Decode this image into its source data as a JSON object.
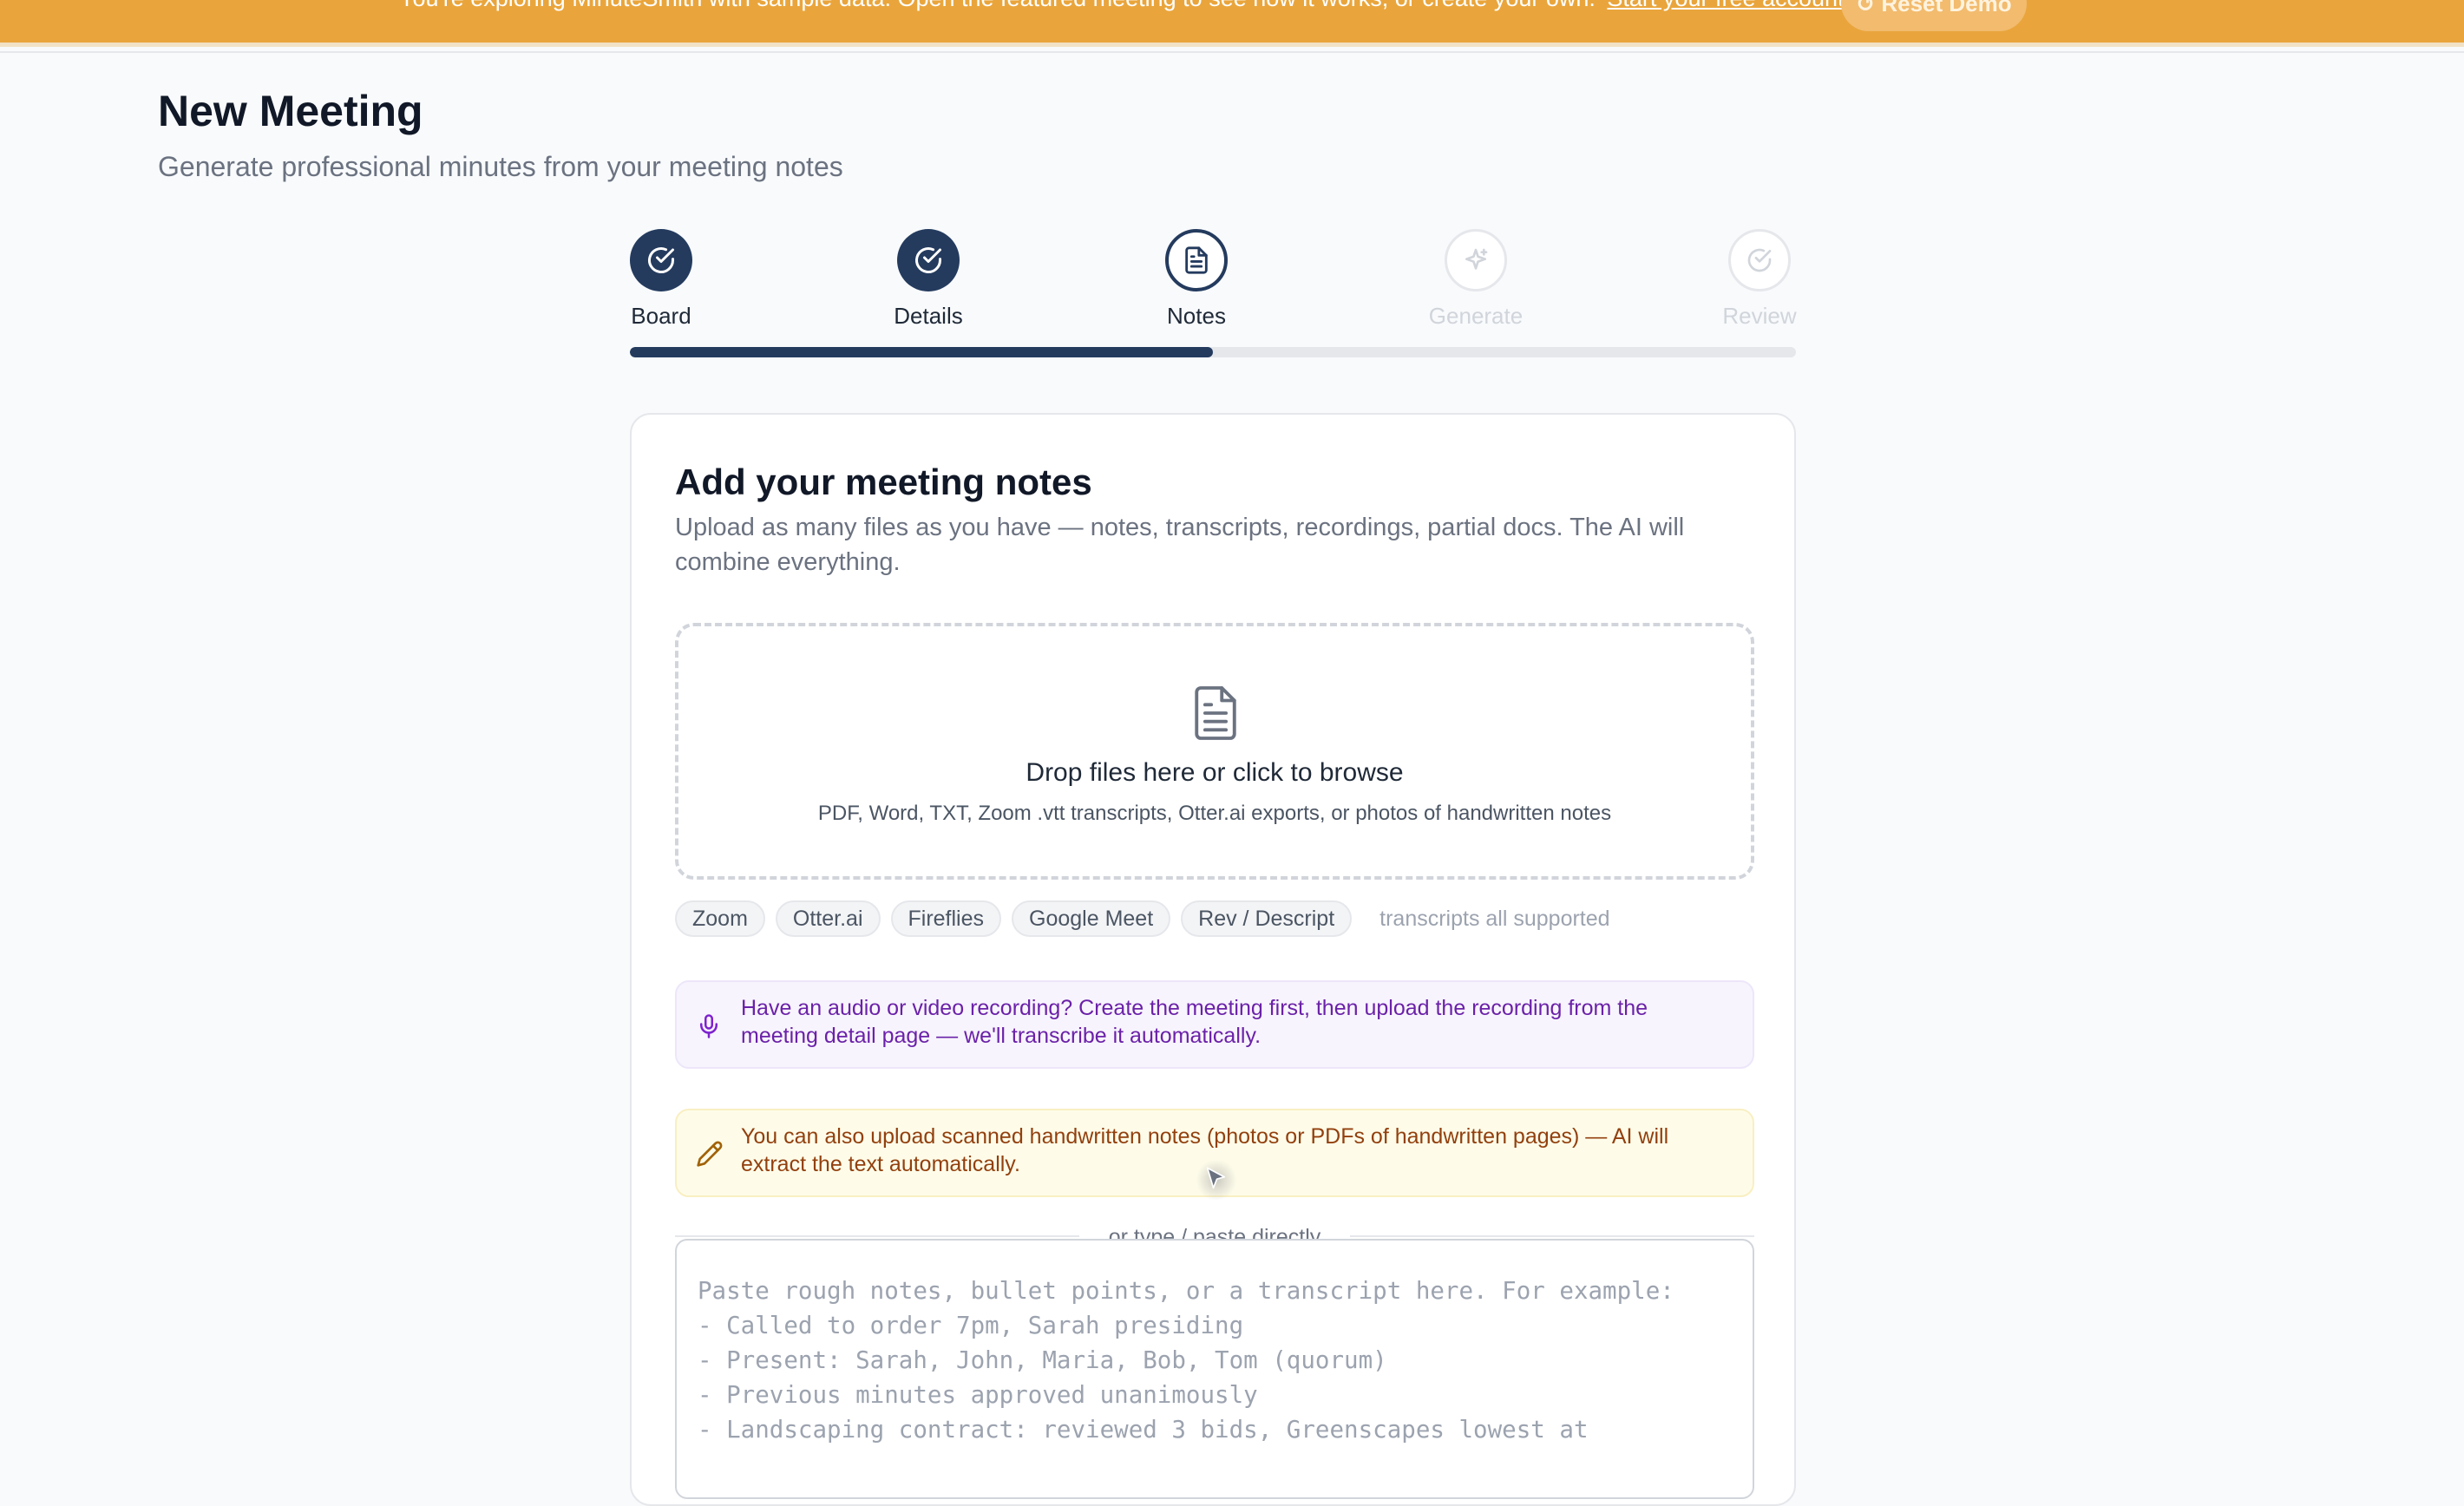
{
  "banner": {
    "message": "You're exploring MinuteSmith with sample data. Open the featured meeting to see how it works, or create your own.",
    "link_label": "Start your free account →",
    "reset_label": "↺ Reset Demo",
    "color": "#e9a53c"
  },
  "page": {
    "title": "New Meeting",
    "subtitle": "Generate professional minutes from your meeting notes"
  },
  "stepper": {
    "steps": [
      {
        "label": "Board",
        "state": "done",
        "icon": "check-circle-icon"
      },
      {
        "label": "Details",
        "state": "done",
        "icon": "check-circle-icon"
      },
      {
        "label": "Notes",
        "state": "current",
        "icon": "document-icon"
      },
      {
        "label": "Generate",
        "state": "future",
        "icon": "sparkles-icon"
      },
      {
        "label": "Review",
        "state": "future",
        "icon": "check-circle-icon"
      }
    ],
    "progress_fraction": 0.5,
    "accent_color": "#243b5e"
  },
  "card": {
    "title": "Add your meeting notes",
    "description": "Upload as many files as you have — notes, transcripts, recordings, partial docs. The AI will combine everything.",
    "dropzone": {
      "icon": "document-icon",
      "title": "Drop files here or click to browse",
      "subtitle": "PDF, Word, TXT, Zoom .vtt transcripts, Otter.ai exports, or photos of handwritten notes"
    },
    "sources": [
      "Zoom",
      "Otter.ai",
      "Fireflies",
      "Google Meet",
      "Rev / Descript"
    ],
    "sources_note": "transcripts all supported",
    "audio_notice": {
      "icon": "microphone-icon",
      "text": "Have an audio or video recording? Create the meeting first, then upload the recording from the meeting detail page — we'll transcribe it automatically."
    },
    "handwritten_notice": {
      "icon": "pencil-icon",
      "text": "You can also upload scanned handwritten notes (photos or PDFs of handwritten pages) — AI will extract the text automatically."
    },
    "divider_label": "or type / paste directly",
    "notes": {
      "value": "",
      "placeholder": "Paste rough notes, bullet points, or a transcript here. For example:\n- Called to order 7pm, Sarah presiding\n- Present: Sarah, John, Maria, Bob, Tom (quorum)\n- Previous minutes approved unanimously\n- Landscaping contract: reviewed 3 bids, Greenscapes lowest at"
    }
  }
}
